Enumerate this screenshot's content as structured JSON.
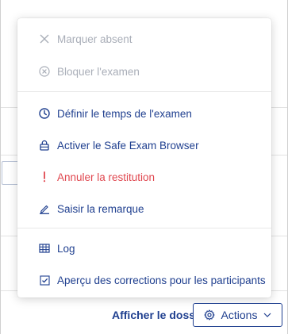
{
  "menu": {
    "items": [
      {
        "label": "Marquer absent",
        "icon": "close-icon",
        "state": "disabled"
      },
      {
        "label": "Bloquer l'examen",
        "icon": "circle-x-icon",
        "state": "disabled"
      },
      {
        "label": "Définir le temps de l'examen",
        "icon": "clock-icon",
        "state": "normal"
      },
      {
        "label": "Activer le Safe Exam Browser",
        "icon": "lock-icon",
        "state": "normal"
      },
      {
        "label": "Annuler la restitution",
        "icon": "exclamation-icon",
        "state": "danger"
      },
      {
        "label": "Saisir la remarque",
        "icon": "pencil-icon",
        "state": "normal"
      },
      {
        "label": "Log",
        "icon": "table-icon",
        "state": "normal"
      },
      {
        "label": "Aperçu des corrections pour les participants",
        "icon": "checkbox-icon",
        "state": "normal"
      }
    ]
  },
  "footer": {
    "show_folder_label": "Afficher le dossier",
    "actions_label": "Actions"
  },
  "colors": {
    "primary": "#1f3f8f",
    "danger": "#e0474f",
    "disabled": "#a9aeb8"
  }
}
